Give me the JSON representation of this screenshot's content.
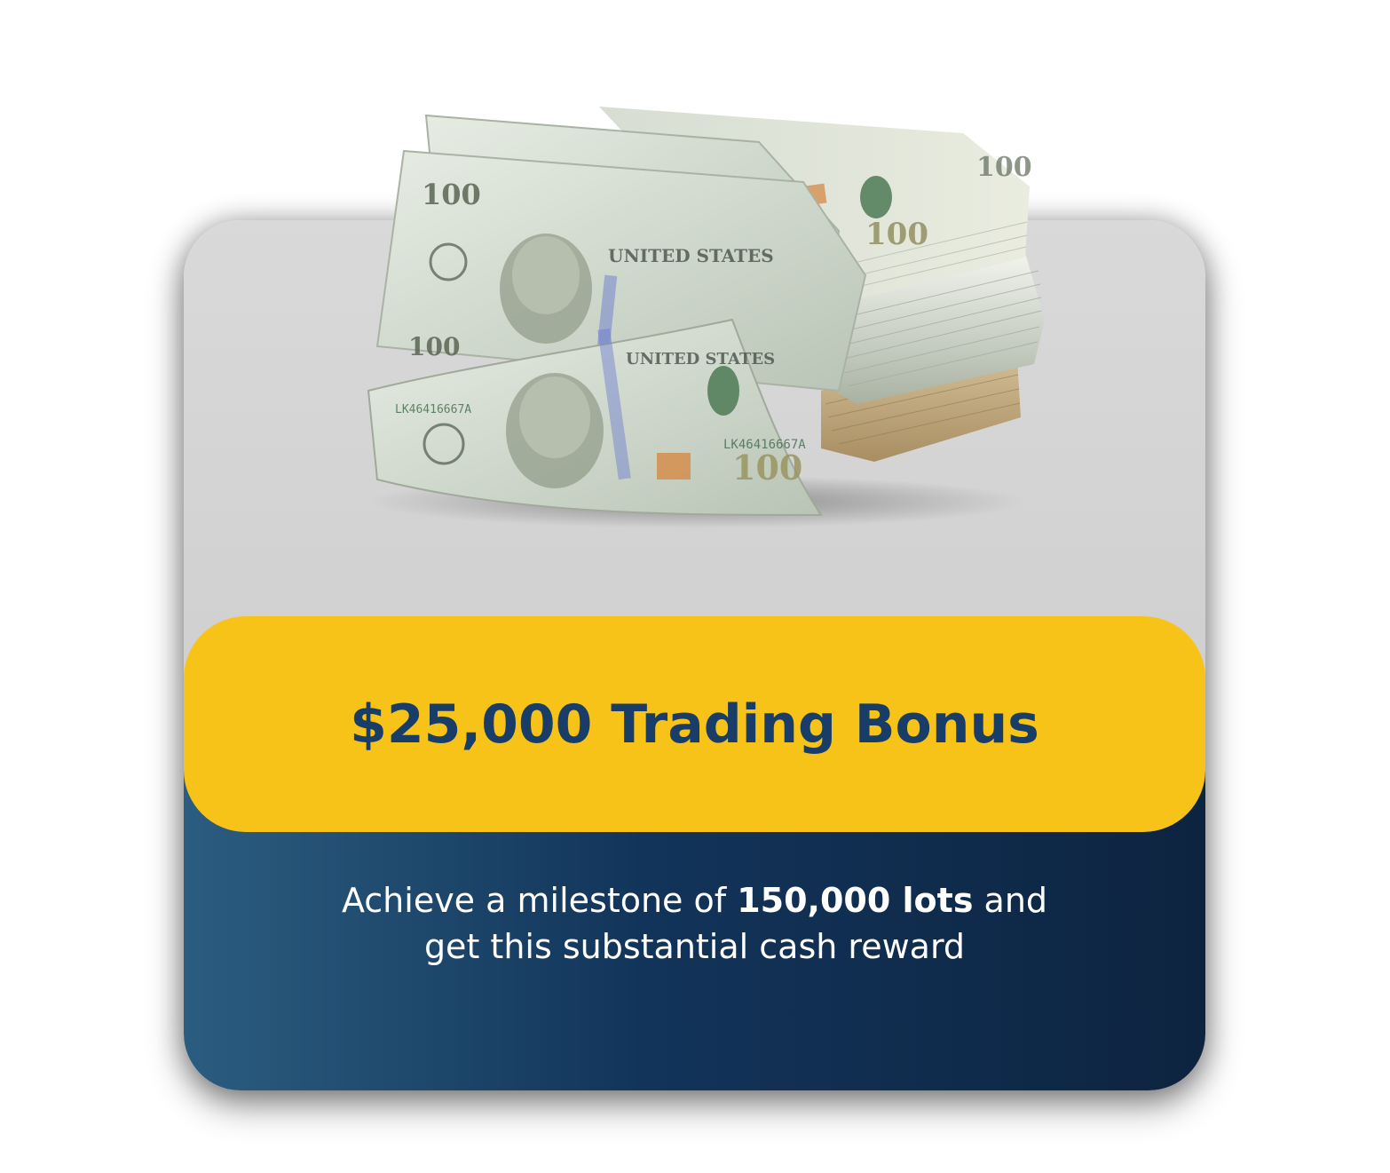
{
  "banner": {
    "title": "$25,000 Trading Bonus"
  },
  "description": {
    "prefix": "Achieve a milestone of ",
    "highlight": "150,000 lots",
    "suffix_line1": " and",
    "line2": "get this substantial cash reward"
  },
  "image": {
    "icon": "cash-stack-icon"
  },
  "colors": {
    "banner": "#f7c319",
    "title_text": "#173d68",
    "card_top": "#d9d9d9",
    "card_bottom_start": "#2b5d80",
    "card_bottom_end": "#0d2440"
  }
}
